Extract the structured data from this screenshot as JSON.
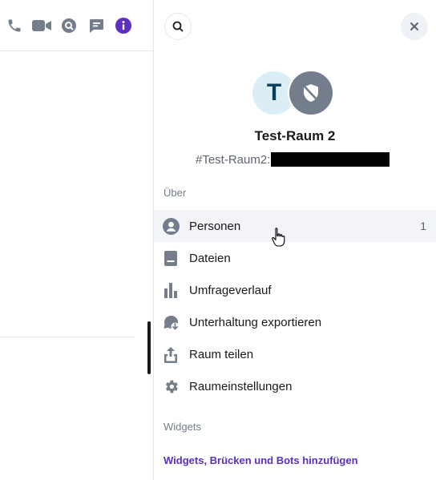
{
  "room": {
    "name": "Test-Raum 2",
    "alias": "#Test-Raum2:",
    "avatar_letter": "T"
  },
  "sections": {
    "about": "Über",
    "widgets": "Widgets"
  },
  "menu": [
    {
      "label": "Personen",
      "icon": "person-icon",
      "count": "1"
    },
    {
      "label": "Dateien",
      "icon": "file-icon"
    },
    {
      "label": "Umfrageverlauf",
      "icon": "poll-icon"
    },
    {
      "label": "Unterhaltung exportieren",
      "icon": "export-icon"
    },
    {
      "label": "Raum teilen",
      "icon": "share-icon"
    },
    {
      "label": "Raumeinstellungen",
      "icon": "settings-icon"
    }
  ],
  "widgets_link": "Widgets, Brücken und Bots hinzufügen",
  "header_icons": [
    "phone-icon",
    "video-icon",
    "search-icon",
    "threads-icon",
    "info-icon"
  ],
  "colors": {
    "accent": "#5b2fbf",
    "icon": "#737d8c",
    "avatar_bg": "#dbeef5",
    "avatar_text": "#0b3d5c",
    "hover_bg": "#f2f4f7"
  }
}
